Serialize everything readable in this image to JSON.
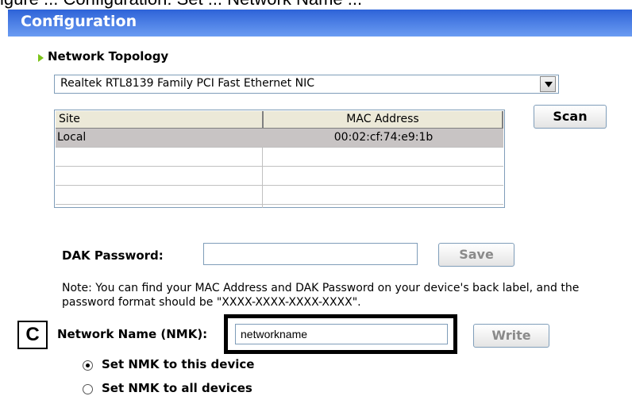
{
  "caption": {
    "text": "igure ... Configuration: Set ... Network Name ..."
  },
  "window": {
    "title": "Configuration"
  },
  "topology": {
    "title": "Network Topology",
    "adapter": "Realtek RTL8139 Family PCI Fast Ethernet NIC",
    "scan_label": "Scan",
    "columns": [
      "Site",
      "MAC Address"
    ],
    "rows": [
      {
        "site": "Local",
        "mac": "00:02:cf:74:e9:1b"
      },
      {
        "site": "",
        "mac": ""
      },
      {
        "site": "",
        "mac": ""
      },
      {
        "site": "",
        "mac": ""
      }
    ]
  },
  "dak": {
    "label": "DAK Password:",
    "value": "",
    "save_label": "Save"
  },
  "note": {
    "text": "Note: You can find your MAC Address and DAK Password on your device's back label, and the password format should be \"XXXX-XXXX-XXXX-XXXX\"."
  },
  "nmk": {
    "callout": "C",
    "label": "Network Name (NMK):",
    "value": "networkname",
    "write_label": "Write",
    "options": [
      {
        "label": "Set NMK to this device",
        "selected": true
      },
      {
        "label": "Set NMK to all devices",
        "selected": false
      }
    ]
  }
}
